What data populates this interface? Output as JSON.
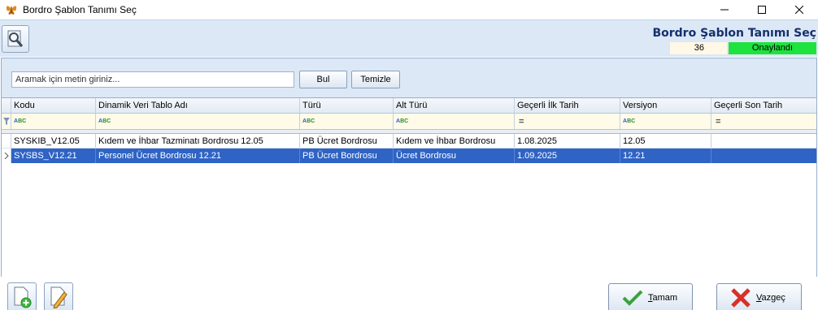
{
  "window": {
    "title": "Bordro Şablon Tanımı Seç"
  },
  "header": {
    "form_title": "Bordro Şablon Tanımı Seç",
    "count": "36",
    "status": "Onaylandı",
    "status_color": "#1ee23e"
  },
  "search": {
    "placeholder": "Aramak için metin giriniz...",
    "value": "",
    "find_label": "Bul",
    "clear_label": "Temizle"
  },
  "grid": {
    "columns": [
      "Kodu",
      "Dinamik Veri Tablo Adı",
      "Türü",
      "Alt Türü",
      "Geçerli İlk Tarih",
      "Versiyon",
      "Geçerli Son Tarih"
    ],
    "filter_types": [
      "abc",
      "abc",
      "abc",
      "abc",
      "eq",
      "abc",
      "eq"
    ],
    "rows": [
      [
        "SYSKIB_V12.05",
        "Kıdem ve İhbar Tazminatı Bordrosu 12.05",
        "PB Ücret Bordrosu",
        "Kıdem ve İhbar Bordrosu",
        "1.08.2025",
        "12.05",
        ""
      ],
      [
        "SYSBS_V12.21",
        "Personel Ücret Bordrosu 12.21",
        "PB Ücret Bordrosu",
        "Ücret Bordrosu",
        "1.09.2025",
        "12.21",
        ""
      ]
    ],
    "selected_row": 1,
    "selection_color": "#2f63c4"
  },
  "footer": {
    "ok_prefix": "",
    "ok_mnemonic": "T",
    "ok_rest": "amam",
    "cancel_mnemonic": "V",
    "cancel_rest": "azgeç"
  },
  "icons": {
    "app": "butterfly-icon",
    "tool": "search-settings-icon",
    "new": "new-document-icon",
    "edit": "edit-document-icon",
    "ok": "checkmark-icon",
    "cancel": "cross-icon"
  }
}
